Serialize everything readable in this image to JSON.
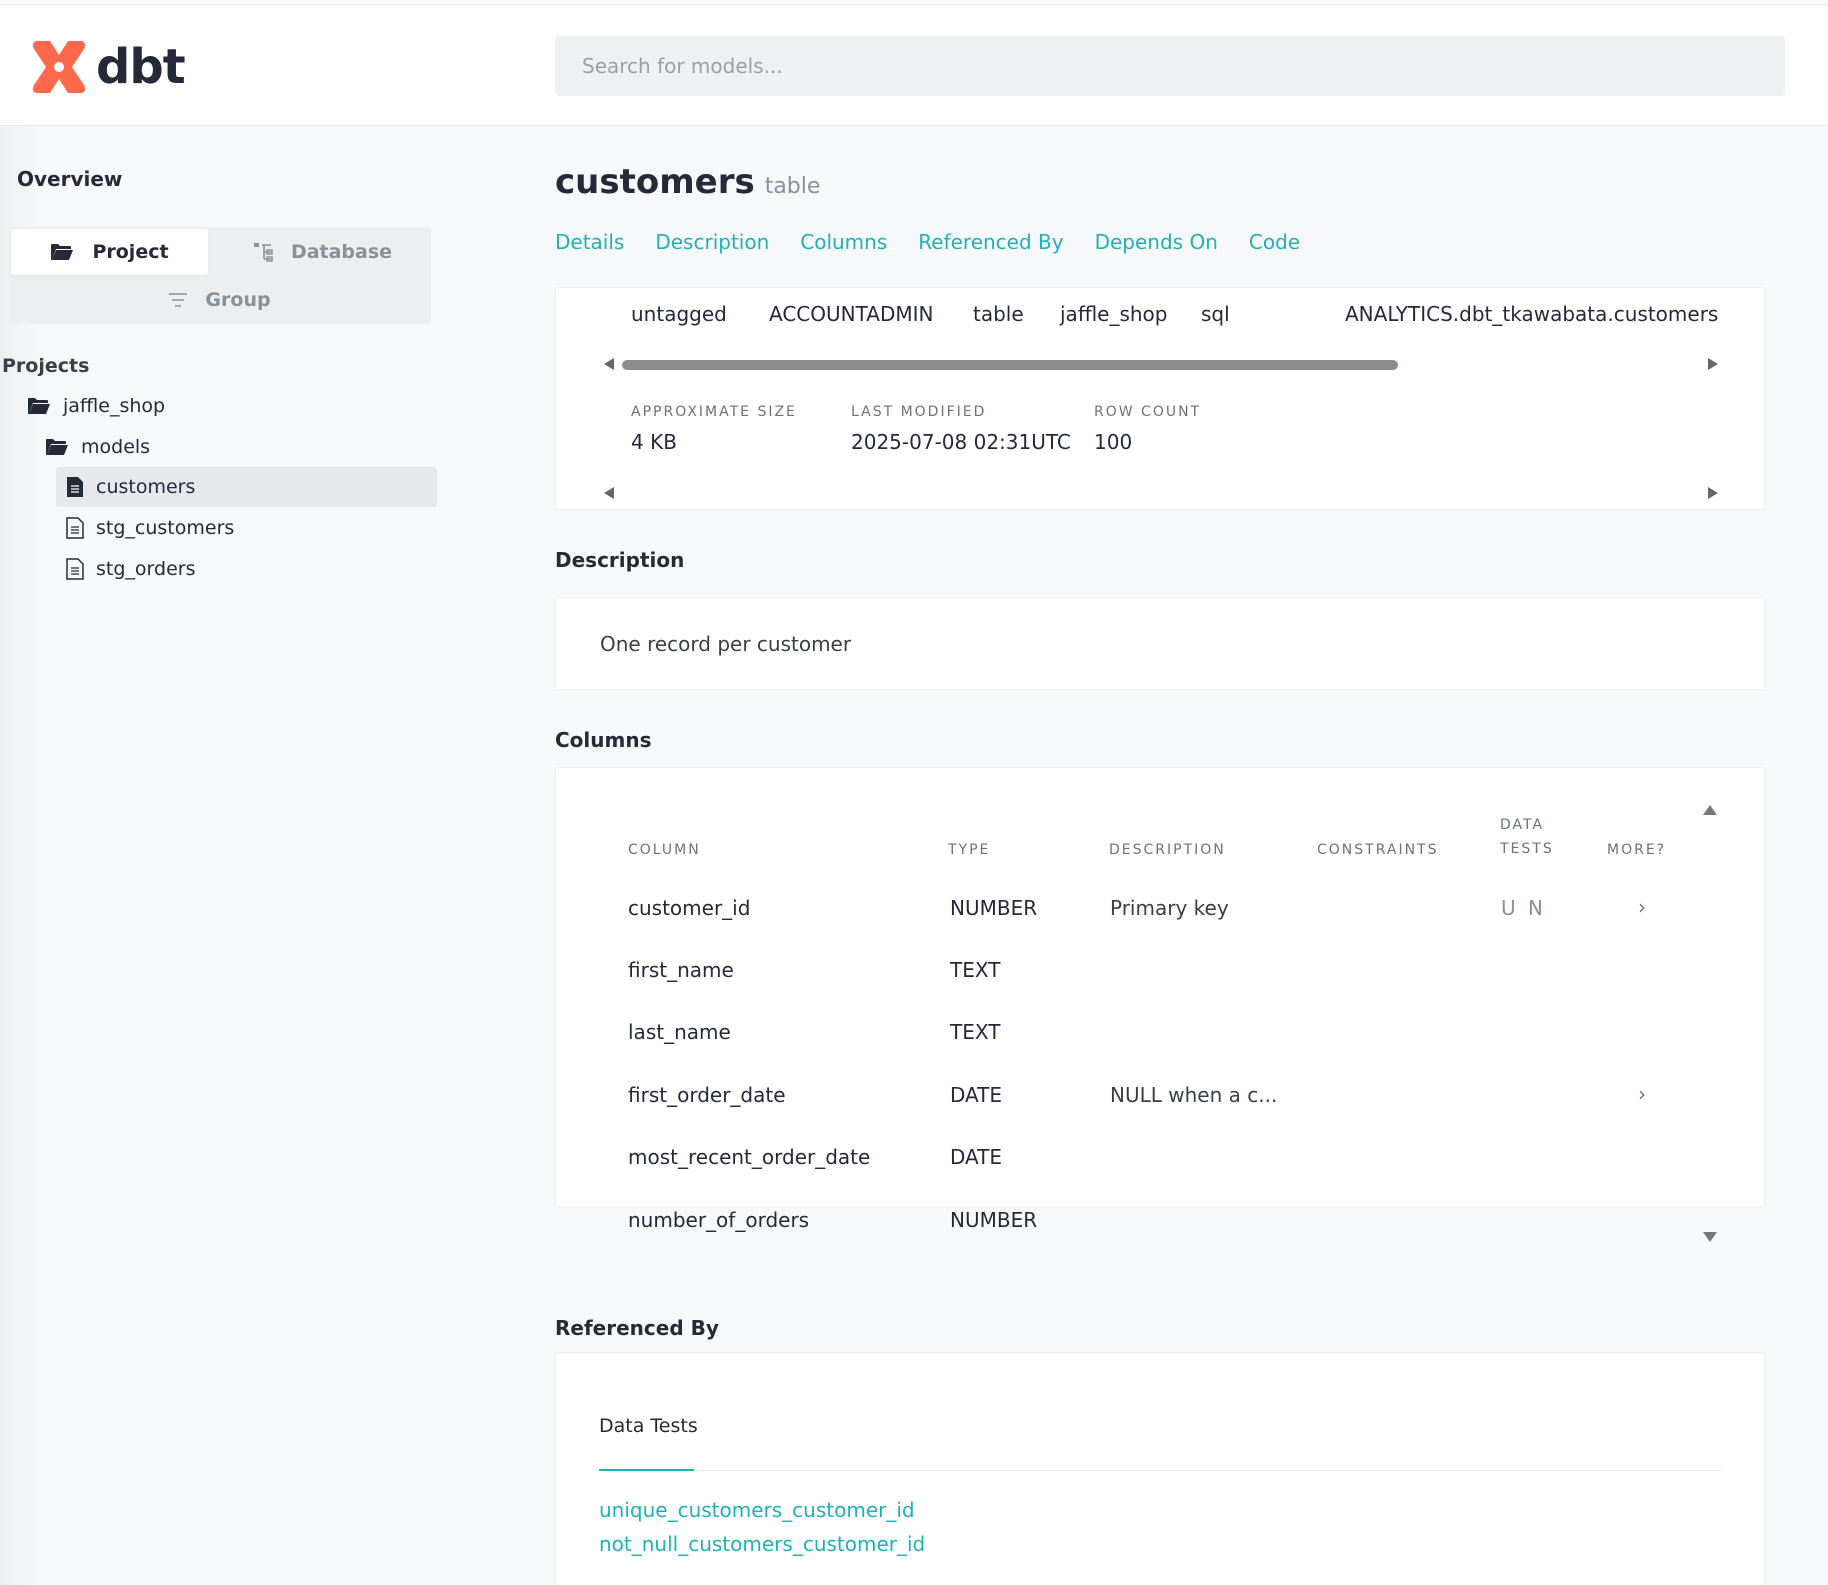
{
  "app": {
    "logo_text": "dbt",
    "brand_color": "#ff694b",
    "accent_color": "#1fb1b8"
  },
  "search": {
    "placeholder": "Search for models..."
  },
  "sidebar": {
    "overview_label": "Overview",
    "toggle": {
      "project_label": "Project",
      "database_label": "Database",
      "group_label": "Group",
      "active": "Project"
    },
    "projects_label": "Projects",
    "tree": [
      {
        "label": "jaffle_shop",
        "icon": "folder-open-icon",
        "level": 0
      },
      {
        "label": "models",
        "icon": "folder-open-icon",
        "level": 1
      },
      {
        "label": "customers",
        "icon": "file-filled-icon",
        "level": 2,
        "selected": true
      },
      {
        "label": "stg_customers",
        "icon": "file-outline-icon",
        "level": 2
      },
      {
        "label": "stg_orders",
        "icon": "file-outline-icon",
        "level": 2
      }
    ]
  },
  "model": {
    "name": "customers",
    "materialization": "table"
  },
  "tabs": [
    "Details",
    "Description",
    "Columns",
    "Referenced By",
    "Depends On",
    "Code"
  ],
  "details": {
    "row_values": [
      "untagged",
      "ACCOUNTADMIN",
      "table",
      "jaffle_shop",
      "sql",
      "ANALYTICS.dbt_tkawabata.customers"
    ],
    "stats": [
      {
        "label": "APPROXIMATE SIZE",
        "value": "4 KB"
      },
      {
        "label": "LAST MODIFIED",
        "value": "2025-07-08 02:31UTC"
      },
      {
        "label": "ROW COUNT",
        "value": "100"
      }
    ]
  },
  "description": {
    "title": "Description",
    "text": "One record per customer"
  },
  "columns": {
    "title": "Columns",
    "headers": {
      "column": "COLUMN",
      "type": "TYPE",
      "description": "DESCRIPTION",
      "constraints": "CONSTRAINTS",
      "data_tests_line1": "DATA",
      "data_tests_line2": "TESTS",
      "more": "MORE?"
    },
    "rows": [
      {
        "name": "customer_id",
        "type": "NUMBER",
        "description": "Primary key",
        "tests": "U N",
        "more": "›"
      },
      {
        "name": "first_name",
        "type": "TEXT",
        "description": "",
        "tests": "",
        "more": ""
      },
      {
        "name": "last_name",
        "type": "TEXT",
        "description": "",
        "tests": "",
        "more": ""
      },
      {
        "name": "first_order_date",
        "type": "DATE",
        "description": "NULL when a c...",
        "tests": "",
        "more": "›"
      },
      {
        "name": "most_recent_order_date",
        "type": "DATE",
        "description": "",
        "tests": "",
        "more": ""
      },
      {
        "name": "number_of_orders",
        "type": "NUMBER",
        "description": "",
        "tests": "",
        "more": ""
      }
    ]
  },
  "referenced_by": {
    "title": "Referenced By",
    "tab_label": "Data Tests",
    "links": [
      "unique_customers_customer_id",
      "not_null_customers_customer_id"
    ]
  }
}
